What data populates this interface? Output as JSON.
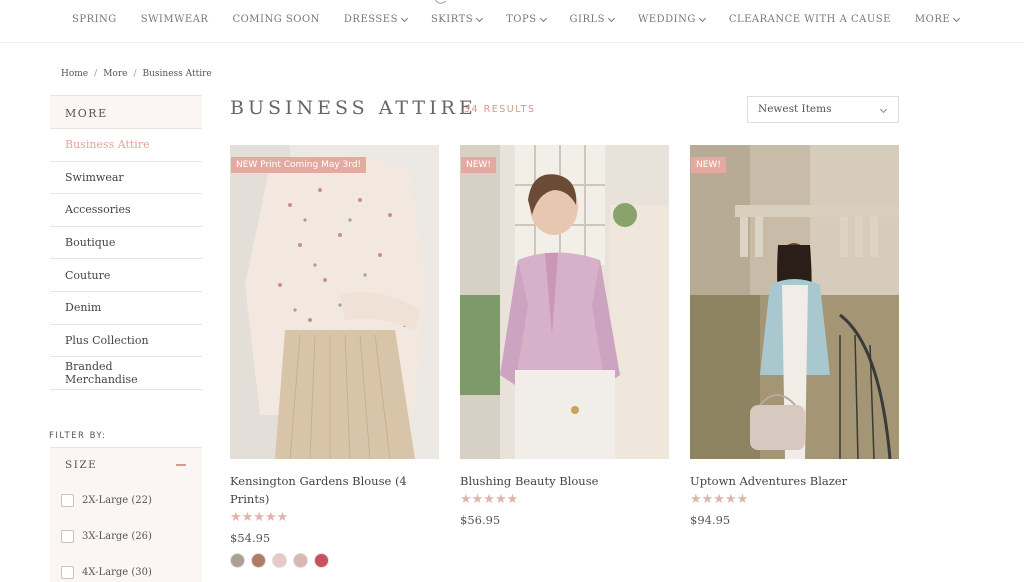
{
  "nav": {
    "items": [
      {
        "label": "SPRING",
        "dropdown": false
      },
      {
        "label": "SWIMWEAR",
        "dropdown": false
      },
      {
        "label": "COMING SOON",
        "dropdown": false
      },
      {
        "label": "DRESSES",
        "dropdown": true
      },
      {
        "label": "SKIRTS",
        "dropdown": true
      },
      {
        "label": "TOPS",
        "dropdown": true
      },
      {
        "label": "GIRLS",
        "dropdown": true
      },
      {
        "label": "WEDDING",
        "dropdown": true
      },
      {
        "label": "CLEARANCE WITH A CAUSE",
        "dropdown": false
      },
      {
        "label": "MORE",
        "dropdown": true
      }
    ]
  },
  "breadcrumb": {
    "home": "Home",
    "more": "More",
    "current": "Business Attire",
    "sep": "/"
  },
  "sidebar": {
    "title": "MORE",
    "items": [
      {
        "label": "Business Attire",
        "active": true
      },
      {
        "label": "Swimwear"
      },
      {
        "label": "Accessories"
      },
      {
        "label": "Boutique"
      },
      {
        "label": "Couture"
      },
      {
        "label": "Denim"
      },
      {
        "label": "Plus Collection"
      },
      {
        "label": "Branded Merchandise"
      }
    ]
  },
  "filter": {
    "label": "FILTER BY:",
    "size_title": "SIZE",
    "sizes": [
      "2X-Large (22)",
      "3X-Large (26)",
      "4X-Large (30)"
    ]
  },
  "header": {
    "title": "BUSINESS ATTIRE",
    "results": "34 RESULTS",
    "sort": "Newest Items"
  },
  "products": [
    {
      "badge": "NEW Print Coming May 3rd!",
      "name": "Kensington Gardens Blouse (4 Prints)",
      "stars": "★★★★★",
      "price": "$54.95",
      "swatches": [
        "#a9a195",
        "#b07a68",
        "#e8c9c4",
        "#d9b7b3",
        "#c8505f"
      ]
    },
    {
      "badge": "NEW!",
      "name": "Blushing Beauty Blouse",
      "stars": "★★★★★",
      "price": "$56.95",
      "swatches": []
    },
    {
      "badge": "NEW!",
      "name": "Uptown Adventures Blazer",
      "stars": "★★★★★",
      "price": "$94.95",
      "swatches": []
    }
  ],
  "colors": {
    "accent": "#e4aaa0",
    "panel": "#fbf6f3",
    "active": "#e2a59b"
  }
}
